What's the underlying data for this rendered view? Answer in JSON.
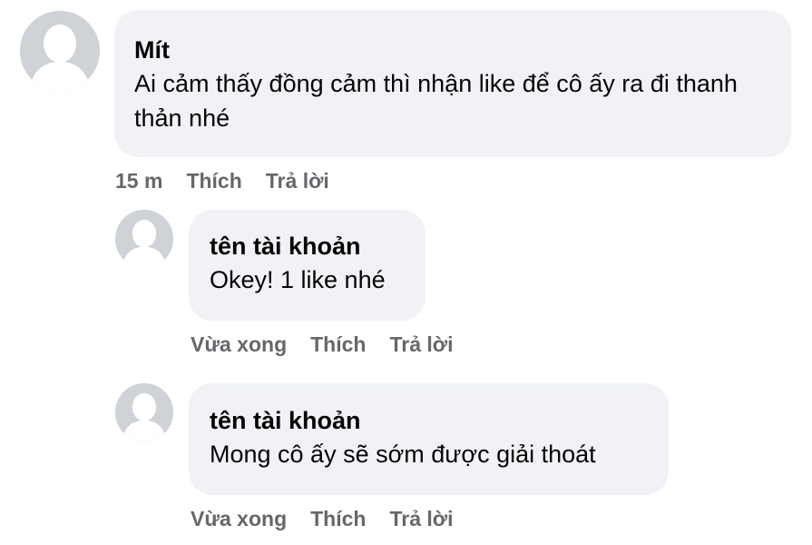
{
  "comments": [
    {
      "author": "Mít",
      "text": "Ai cảm thấy đồng cảm thì nhận like để cô ấy ra đi thanh thản nhé",
      "time": "15 m",
      "like_label": "Thích",
      "reply_label": "Trả lời"
    },
    {
      "author": "tên tài khoản",
      "text": "Okey! 1 like nhé",
      "time": "Vừa xong",
      "like_label": "Thích",
      "reply_label": "Trả lời"
    },
    {
      "author": "tên tài khoản",
      "text": "Mong cô ấy sẽ sớm được giải thoát",
      "time": "Vừa xong",
      "like_label": "Thích",
      "reply_label": "Trả lời"
    }
  ],
  "icons": {
    "avatar": "default-user-silhouette-icon"
  },
  "colors": {
    "bubble": "#f0f2f5",
    "meta_text": "#65676b",
    "avatar_bg": "#cfd3d8"
  }
}
